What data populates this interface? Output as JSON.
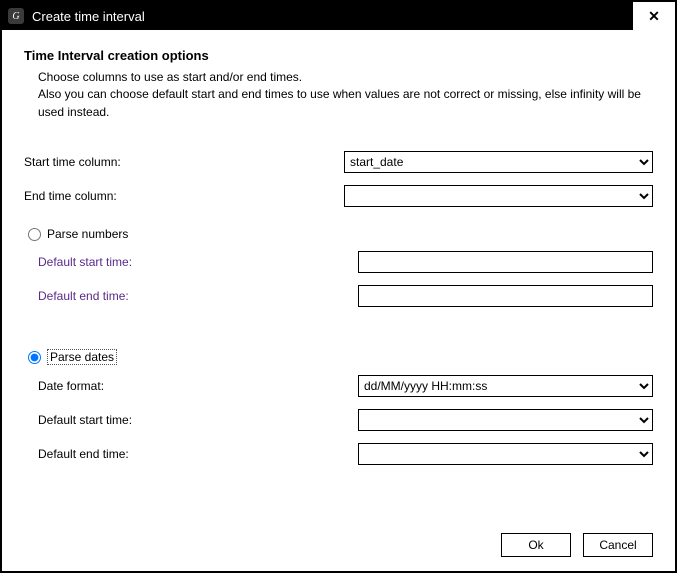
{
  "window": {
    "title": "Create time interval"
  },
  "heading": "Time Interval creation options",
  "description": "Choose columns to use as start and/or end times.\nAlso you can choose default start and end times to use when values are not correct or missing, else infinity will be used instead.",
  "columns": {
    "start_label": "Start time column:",
    "start_value": "start_date",
    "end_label": "End time column:",
    "end_value": ""
  },
  "parse_numbers": {
    "radio_label": "Parse numbers",
    "selected": false,
    "default_start_label": "Default start time:",
    "default_start_value": "",
    "default_end_label": "Default end time:",
    "default_end_value": ""
  },
  "parse_dates": {
    "radio_label": "Parse dates",
    "selected": true,
    "date_format_label": "Date format:",
    "date_format_value": "dd/MM/yyyy HH:mm:ss",
    "default_start_label": "Default start time:",
    "default_start_value": "",
    "default_end_label": "Default end time:",
    "default_end_value": ""
  },
  "buttons": {
    "ok": "Ok",
    "cancel": "Cancel"
  }
}
